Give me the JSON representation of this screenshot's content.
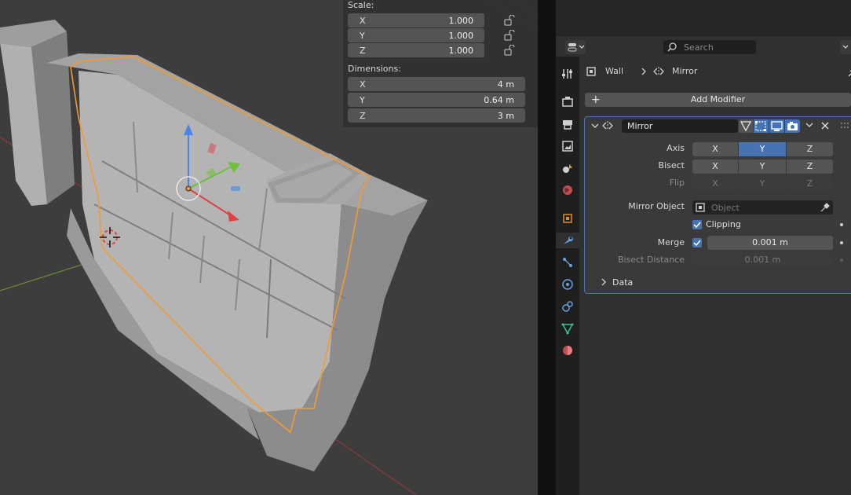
{
  "npanel": {
    "scale_label": "Scale:",
    "scale": [
      {
        "axis": "X",
        "value": "1.000"
      },
      {
        "axis": "Y",
        "value": "1.000"
      },
      {
        "axis": "Z",
        "value": "1.000"
      }
    ],
    "dimensions_label": "Dimensions:",
    "dimensions": [
      {
        "axis": "X",
        "value": "4 m"
      },
      {
        "axis": "Y",
        "value": "0.64 m"
      },
      {
        "axis": "Z",
        "value": "3 m"
      }
    ]
  },
  "properties": {
    "search_placeholder": "Search",
    "breadcrumb": {
      "object": "Wall",
      "modifier": "Mirror"
    },
    "add_modifier_label": "Add Modifier",
    "modifier": {
      "name": "Mirror",
      "axis_label": "Axis",
      "bisect_label": "Bisect",
      "flip_label": "Flip",
      "axis_x": "X",
      "axis_y": "Y",
      "axis_z": "Z",
      "mirror_object_label": "Mirror Object",
      "mirror_object_placeholder": "Object",
      "clipping_label": "Clipping",
      "merge_label": "Merge",
      "merge_value": "0.001 m",
      "bisect_distance_label": "Bisect Distance",
      "bisect_distance_value": "0.001 m",
      "data_label": "Data"
    }
  },
  "colors": {
    "accent": "#4772b3",
    "selection_outline": "#f29a33",
    "viewport_bg": "#3d3d3d"
  }
}
